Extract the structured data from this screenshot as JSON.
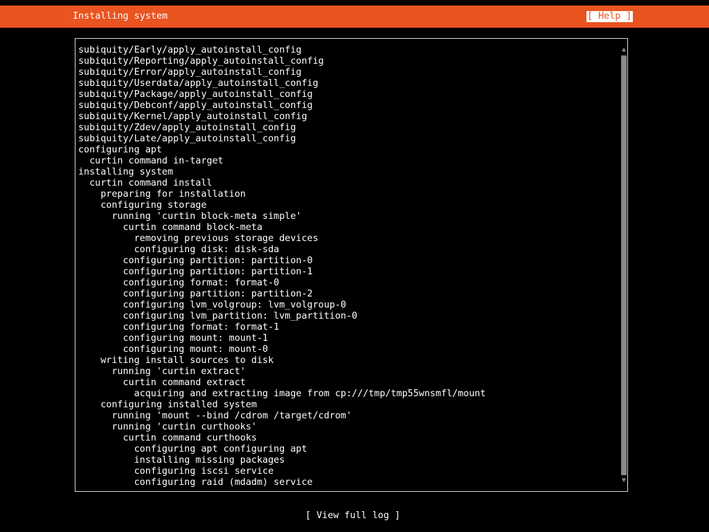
{
  "header": {
    "title": "Installing system",
    "help_label": "[ Help ]"
  },
  "log": {
    "lines": [
      "subiquity/Early/apply_autoinstall_config",
      "subiquity/Reporting/apply_autoinstall_config",
      "subiquity/Error/apply_autoinstall_config",
      "subiquity/Userdata/apply_autoinstall_config",
      "subiquity/Package/apply_autoinstall_config",
      "subiquity/Debconf/apply_autoinstall_config",
      "subiquity/Kernel/apply_autoinstall_config",
      "subiquity/Zdev/apply_autoinstall_config",
      "subiquity/Late/apply_autoinstall_config",
      "configuring apt",
      "  curtin command in-target",
      "installing system",
      "  curtin command install",
      "    preparing for installation",
      "    configuring storage",
      "      running 'curtin block-meta simple'",
      "        curtin command block-meta",
      "          removing previous storage devices",
      "          configuring disk: disk-sda",
      "        configuring partition: partition-0",
      "        configuring partition: partition-1",
      "        configuring format: format-0",
      "        configuring partition: partition-2",
      "        configuring lvm_volgroup: lvm_volgroup-0",
      "        configuring lvm_partition: lvm_partition-0",
      "        configuring format: format-1",
      "        configuring mount: mount-1",
      "        configuring mount: mount-0",
      "    writing install sources to disk",
      "      running 'curtin extract'",
      "        curtin command extract",
      "          acquiring and extracting image from cp:///tmp/tmp55wnsmfl/mount",
      "    configuring installed system",
      "      running 'mount --bind /cdrom /target/cdrom'",
      "      running 'curtin curthooks'",
      "        curtin command curthooks",
      "          configuring apt configuring apt",
      "          installing missing packages",
      "          configuring iscsi service",
      "          configuring raid (mdadm) service"
    ]
  },
  "scrollbar": {
    "up_icon": "▲",
    "down_icon": "▼"
  },
  "footer": {
    "view_log_label": "[ View full log ]"
  },
  "colors": {
    "accent": "#e95420",
    "background": "#000000",
    "text": "#ffffff",
    "scrollbar": "#8a8a8a"
  }
}
